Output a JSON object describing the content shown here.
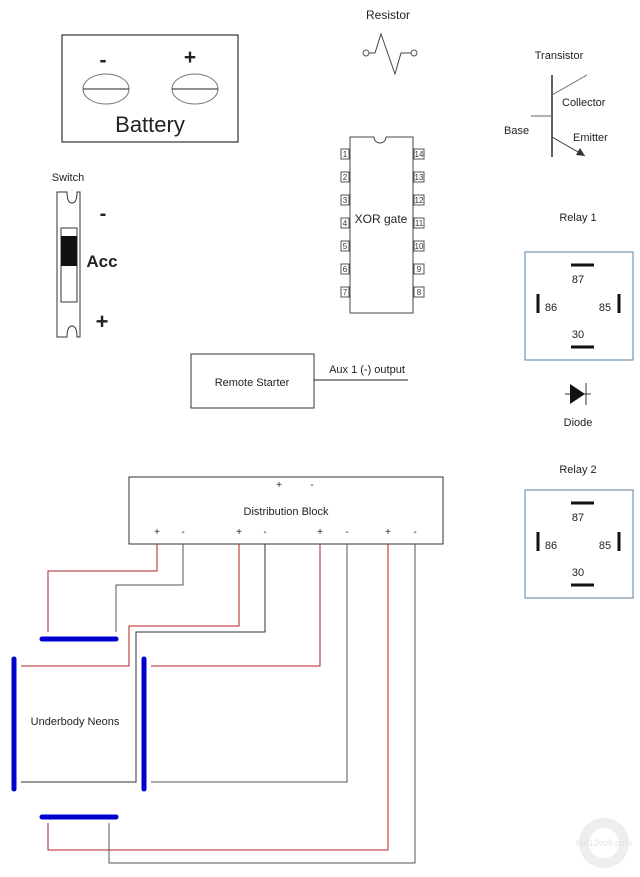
{
  "battery": {
    "label": "Battery",
    "neg": "-",
    "pos": "+"
  },
  "resistor": {
    "label": "Resistor"
  },
  "transistor": {
    "label": "Transistor",
    "collector": "Collector",
    "base": "Base",
    "emitter": "Emitter"
  },
  "xor": {
    "label": "XOR gate",
    "left_pins": [
      "1",
      "2",
      "3",
      "4",
      "5",
      "6",
      "7"
    ],
    "right_pins": [
      "14",
      "13",
      "12",
      "11",
      "10",
      "9",
      "8"
    ]
  },
  "switch": {
    "label": "Switch",
    "neg": "-",
    "pos": "+",
    "position": "Acc"
  },
  "relay1": {
    "label": "Relay 1",
    "p87": "87",
    "p86": "86",
    "p85": "85",
    "p30": "30"
  },
  "diode": {
    "label": "Diode"
  },
  "relay2": {
    "label": "Relay 2",
    "p87": "87",
    "p86": "86",
    "p85": "85",
    "p30": "30"
  },
  "remote": {
    "label": "Remote Starter",
    "output": "Aux 1 (-) output"
  },
  "dist": {
    "label": "Distribution Block",
    "top_pos": "+",
    "top_neg": "-",
    "terminals": [
      "+",
      "-",
      "+",
      "-",
      "+",
      "-",
      "+",
      "-"
    ]
  },
  "neons": {
    "label": "Underbody Neons"
  },
  "colors": {
    "wire_pos": "#b22222",
    "wire_neg": "#333333",
    "neon": "#0000cc",
    "relay_border": "#5a7fa0"
  },
  "watermark": "the12volt.com"
}
